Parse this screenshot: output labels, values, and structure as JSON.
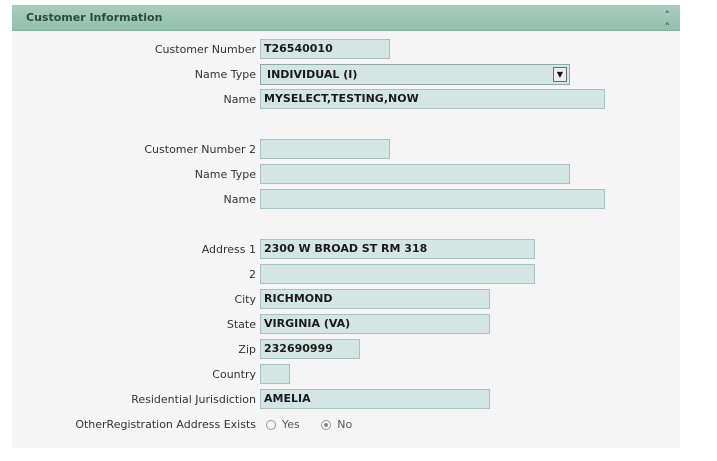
{
  "panel": {
    "title": "Customer Information",
    "collapse_icon": "double-chevron-up-icon"
  },
  "customer1": {
    "number_label": "Customer Number",
    "number_value": "T26540010",
    "name_type_label": "Name Type",
    "name_type_value": "INDIVIDUAL (I)",
    "name_label": "Name",
    "name_value": "MYSELECT,TESTING,NOW"
  },
  "customer2": {
    "number_label": "Customer Number 2",
    "number_value": "",
    "name_type_label": "Name Type",
    "name_type_value": "",
    "name_label": "Name",
    "name_value": ""
  },
  "address": {
    "address1_label": "Address 1",
    "address1_value": "2300 W BROAD ST RM 318",
    "address2_label": "2",
    "address2_value": "",
    "city_label": "City",
    "city_value": "RICHMOND",
    "state_label": "State",
    "state_value": "VIRGINIA (VA)",
    "zip_label": "Zip",
    "zip_value": "232690999",
    "country_label": "Country",
    "country_value": "",
    "jurisdiction_label": "Residential Jurisdiction",
    "jurisdiction_value": "AMELIA"
  },
  "other_registration": {
    "label": "OtherRegistration Address Exists",
    "options": [
      "Yes",
      "No"
    ],
    "selected": "No"
  },
  "colors": {
    "header": "#9fc7b8",
    "field_bg": "#d4e6e3",
    "panel_bg": "#f5f5f5"
  }
}
